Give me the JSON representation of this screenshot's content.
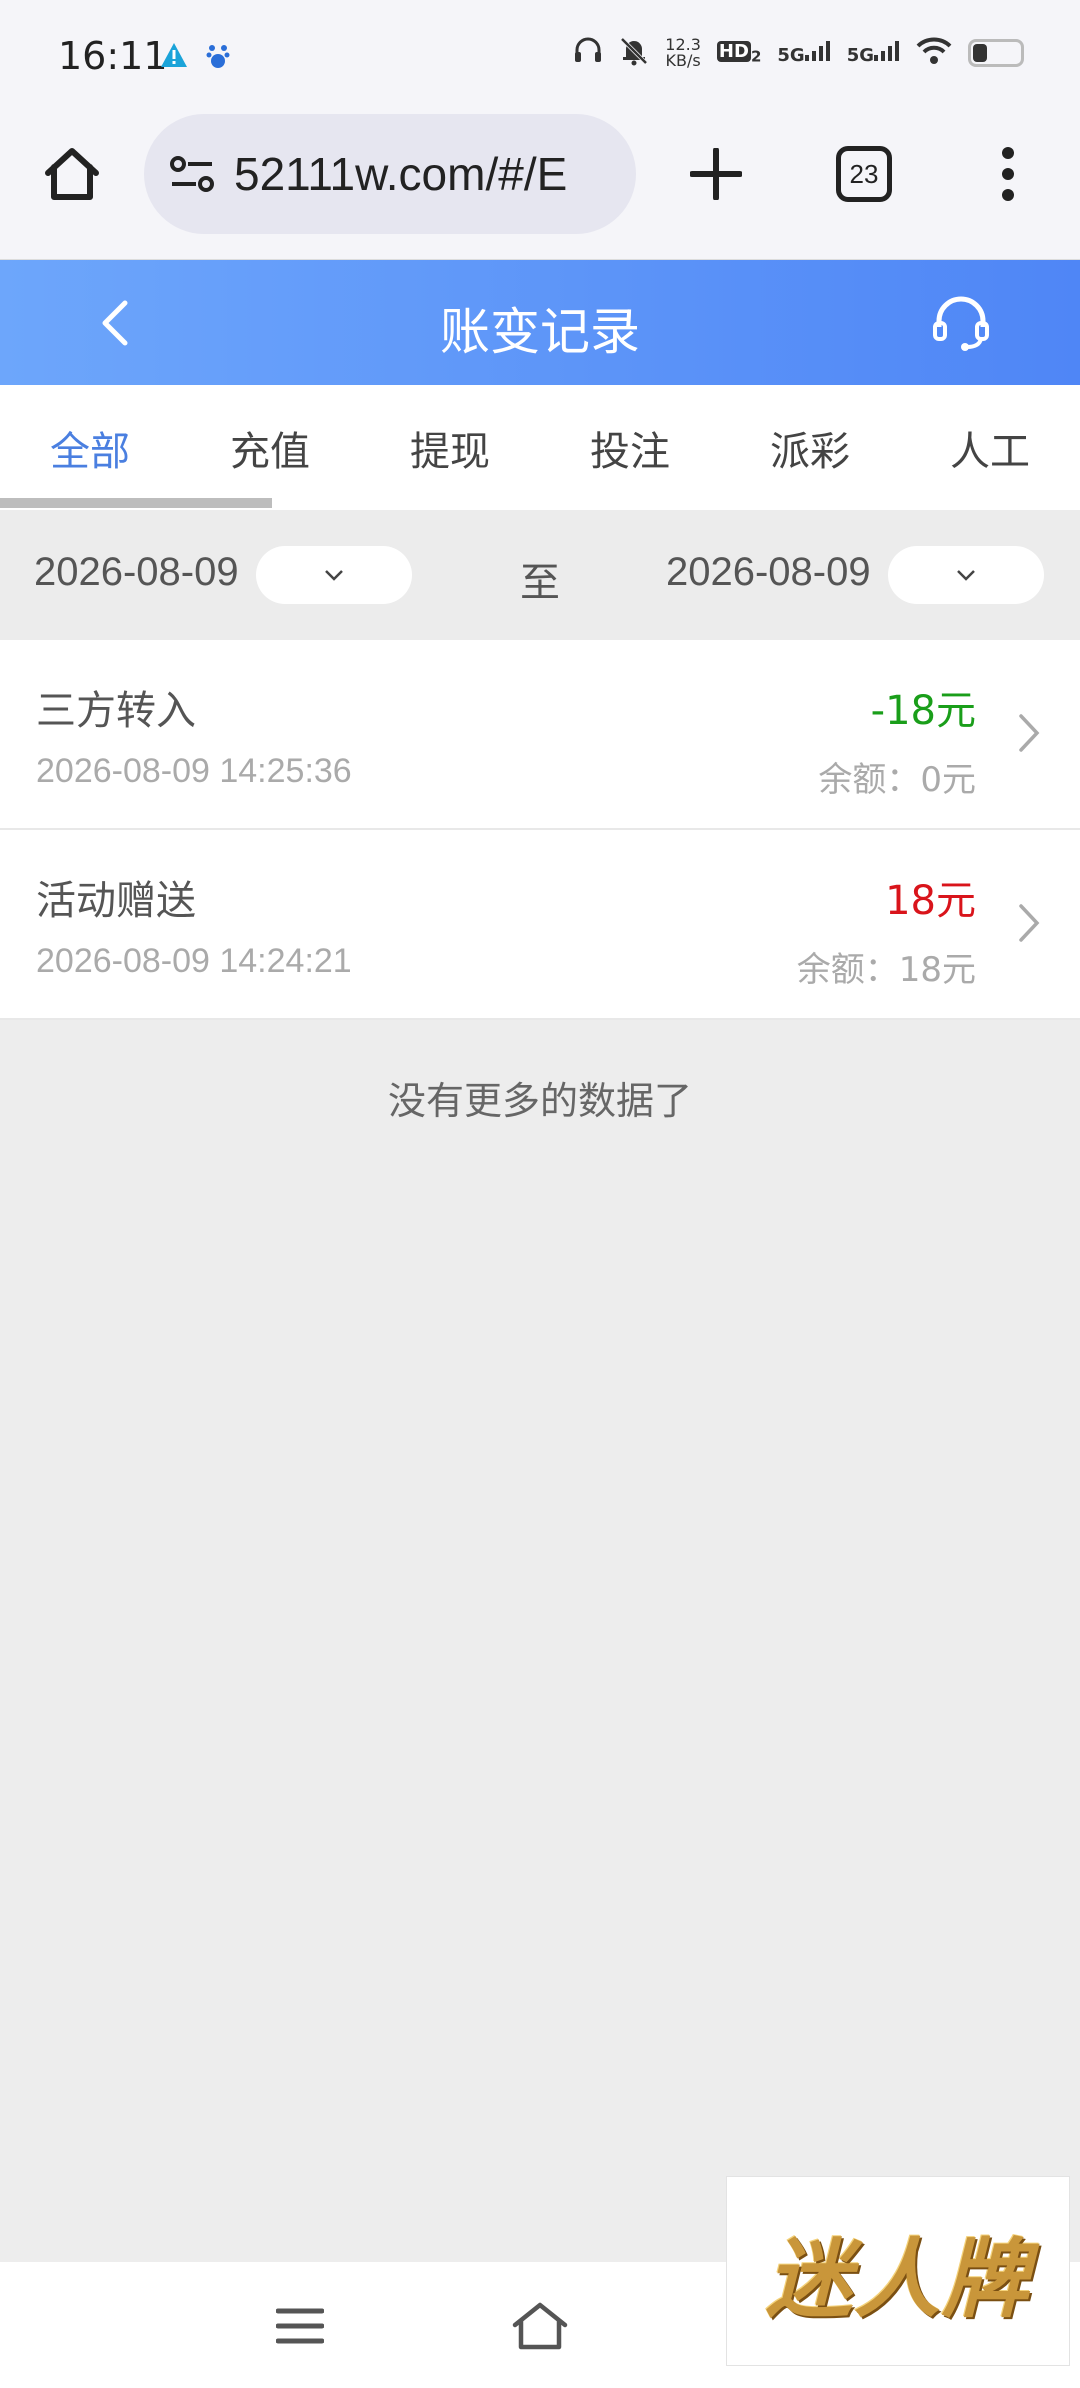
{
  "status_bar": {
    "time": "16:11",
    "net_speed_value": "12.3",
    "net_speed_unit": "KB/s",
    "hd_label": "HD",
    "hd_sub": "2",
    "signal1": "5G",
    "signal2": "5G"
  },
  "browser": {
    "url": "52111w.com/#/E",
    "tab_count": "23"
  },
  "header": {
    "title": "账变记录"
  },
  "tabs": [
    {
      "label": "全部",
      "active": true
    },
    {
      "label": "充值",
      "active": false
    },
    {
      "label": "提现",
      "active": false
    },
    {
      "label": "投注",
      "active": false
    },
    {
      "label": "派彩",
      "active": false
    },
    {
      "label": "人工",
      "active": false
    }
  ],
  "date_filter": {
    "start": "2026-08-09",
    "separator": "至",
    "end": "2026-08-09"
  },
  "records": [
    {
      "title": "三方转入",
      "time": "2026-08-09 14:25:36",
      "amount": "-18元",
      "balance": "余额：0元"
    },
    {
      "title": "活动赠送",
      "time": "2026-08-09 14:24:21",
      "amount": "18元",
      "balance": "余额：18元"
    }
  ],
  "no_more_text": "没有更多的数据了",
  "watermark": "迷人牌",
  "colors": {
    "header_gradient_start": "#6da6fb",
    "header_gradient_end": "#4f86f6",
    "active_tab": "#4a7fe0",
    "negative_amount": "#1a9e1a",
    "positive_amount": "#d9141b"
  }
}
